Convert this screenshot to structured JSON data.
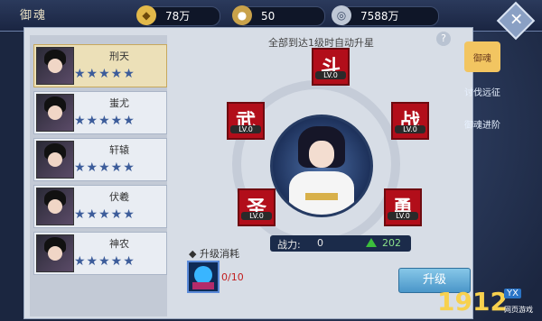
{
  "title": "御魂",
  "resources": [
    {
      "icon": "gold-ingot-icon",
      "value": "78万"
    },
    {
      "icon": "coin-bag-icon",
      "value": "50"
    },
    {
      "icon": "copper-coin-icon",
      "value": "7588万"
    }
  ],
  "heroes": [
    {
      "name": "刑天",
      "stars": "★★★★★"
    },
    {
      "name": "蚩尤",
      "stars": "★★★★★"
    },
    {
      "name": "轩辕",
      "stars": "★★★★★"
    },
    {
      "name": "伏羲",
      "stars": "★★★★★"
    },
    {
      "name": "神农",
      "stars": "★★★★★"
    }
  ],
  "main": {
    "hint": "全部到达1级时自动升星",
    "help": "?",
    "slots": [
      {
        "char": "斗",
        "level": "LV.0"
      },
      {
        "char": "武",
        "level": "LV.0"
      },
      {
        "char": "战",
        "level": "LV.0"
      },
      {
        "char": "圣",
        "level": "LV.0"
      },
      {
        "char": "勇",
        "level": "LV.0"
      }
    ],
    "power_label": "战力:",
    "power_value": "0",
    "power_gain": "202",
    "cost_title": "升级消耗",
    "cost_count": "0/10",
    "upgrade_label": "升级"
  },
  "tabs": [
    {
      "label": "御魂"
    },
    {
      "label": "讨伐远征"
    },
    {
      "label": "御魂进阶"
    }
  ],
  "logo": {
    "main": "1912",
    "badge": "YX",
    "sub": "网页游戏"
  }
}
